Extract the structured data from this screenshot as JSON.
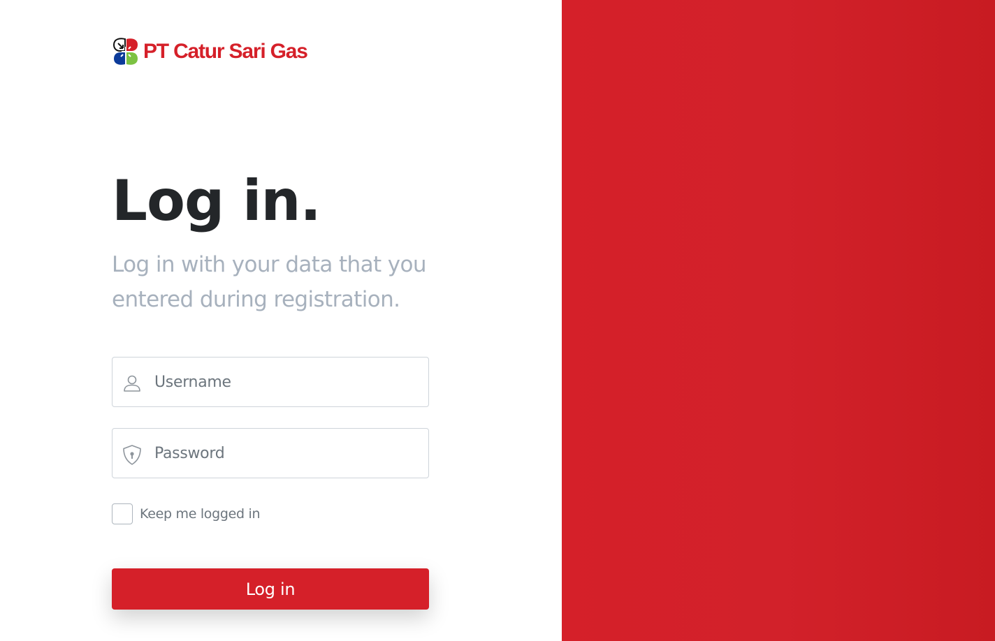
{
  "brand": {
    "name": "PT Catur Sari Gas",
    "logo_icon": "four-leaf-logo-icon",
    "colors": {
      "red": "#d52029",
      "blue": "#0c3b9a",
      "green": "#7cc242",
      "black": "#111111"
    }
  },
  "login": {
    "title": "Log in.",
    "subtitle": "Log in with your data that you entered during registration.",
    "username": {
      "placeholder": "Username",
      "value": "",
      "icon": "user-icon"
    },
    "password": {
      "placeholder": "Password",
      "value": "",
      "icon": "shield-lock-icon"
    },
    "remember_label": "Keep me logged in",
    "remember_checked": false,
    "submit_label": "Log in"
  },
  "theme": {
    "accent": "#d52029",
    "panel": "#d2212a",
    "title_color": "#232629",
    "subtitle_color": "#a7b1bd"
  }
}
